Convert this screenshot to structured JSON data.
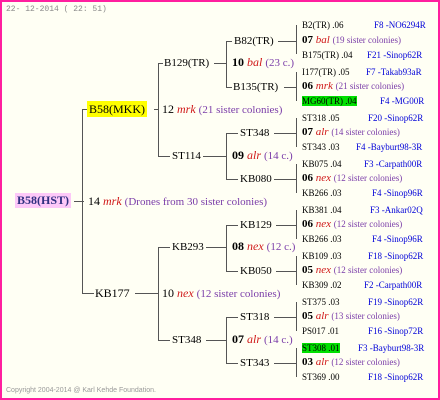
{
  "header": {
    "stamp": "22- 12-2014 ( 22: 51)"
  },
  "footer": {
    "copyright": "Copyright 2004-2014 @ Karl Kehde Foundation."
  },
  "root": {
    "name": "B58(HST)"
  },
  "gen1": {
    "drones": {
      "num": "14",
      "abbr": "mrk",
      "note": "(Drones from 30 sister colonies)"
    },
    "queen_top": {
      "name": "B58(MKK)",
      "num": "12",
      "abbr": "mrk",
      "note": "(21 sister colonies)"
    },
    "queen_bottom": {
      "name": "KB177",
      "num": "10",
      "abbr": "nex",
      "note": "(12 sister colonies)"
    }
  },
  "gen2": {
    "b129": {
      "name": "B129(TR)",
      "num": "10",
      "abbr": "bal",
      "note": "(23 c.)"
    },
    "st114": {
      "name": "ST114",
      "num": "09",
      "abbr": "alr",
      "note": "(14 c.)"
    },
    "kb293": {
      "name": "KB293",
      "num": "08",
      "abbr": "nex",
      "note": "(12 c.)"
    },
    "st348": {
      "name": "ST348",
      "num": "07",
      "abbr": "alr",
      "note": "(14 c.)"
    }
  },
  "gen3": {
    "b82": "B82(TR)",
    "b135": "B135(TR)",
    "st348": "ST348",
    "kb080": "KB080",
    "kb129": "KB129",
    "kb050": "KB050",
    "st318": "ST318",
    "st343": "ST343"
  },
  "gen4": [
    {
      "top": {
        "name": "B2(TR)",
        "yr": ".06",
        "loc": "F8 -NO6294R"
      },
      "num": "07",
      "abbr": "bal",
      "note": "(19 sister colonies)",
      "bottom": {
        "name": "B175(TR)",
        "yr": ".04",
        "loc": "F21 -Sinop62R"
      }
    },
    {
      "top": {
        "name": "I177(TR)",
        "yr": ".05",
        "loc": "F7 -Takab93aR"
      },
      "num": "06",
      "abbr": "mrk",
      "note": "(21 sister colonies)",
      "bottom": {
        "name": "MG60(TR)",
        "yr": ".04",
        "loc": "F4 -MG00R"
      }
    },
    {
      "top": {
        "name": "ST318",
        "yr": ".05",
        "loc": "F20 -Sinop62R"
      },
      "num": "07",
      "abbr": "alr",
      "note": "(14 sister colonies)",
      "bottom": {
        "name": "ST343",
        "yr": ".03",
        "loc": "F4 -Bayburt98-3R"
      }
    },
    {
      "top": {
        "name": "KB075",
        "yr": ".04",
        "loc": "F3 -Carpath00R"
      },
      "num": "06",
      "abbr": "nex",
      "note": "(12 sister colonies)",
      "bottom": {
        "name": "KB266",
        "yr": ".03",
        "loc": "F4 -Sinop96R"
      }
    },
    {
      "top": {
        "name": "KB381",
        "yr": ".04",
        "loc": "F3 -Ankar02Q"
      },
      "num": "06",
      "abbr": "nex",
      "note": "(12 sister colonies)",
      "bottom": {
        "name": "KB266",
        "yr": ".03",
        "loc": "F4 -Sinop96R"
      }
    },
    {
      "top": {
        "name": "KB109",
        "yr": ".03",
        "loc": "F18 -Sinop62R"
      },
      "num": "05",
      "abbr": "nex",
      "note": "(12 sister colonies)",
      "bottom": {
        "name": "KB309",
        "yr": ".02",
        "loc": "F2 -Carpath00R"
      }
    },
    {
      "top": {
        "name": "ST375",
        "yr": ".03",
        "loc": "F19 -Sinop62R"
      },
      "num": "05",
      "abbr": "alr",
      "note": "(13 sister colonies)",
      "bottom": {
        "name": "PS017",
        "yr": ".01",
        "loc": "F16 -Sinop72R"
      }
    },
    {
      "top": {
        "name": "ST308",
        "yr": ".01",
        "loc": "F3 -Bayburt98-3R"
      },
      "num": "03",
      "abbr": "alr",
      "note": "(12 sister colonies)",
      "bottom": {
        "name": "ST369",
        "yr": ".00",
        "loc": "F18 -Sinop62R"
      }
    }
  ],
  "colors": {
    "border": "#ff1f9f",
    "highlight_green": "#00e000",
    "highlight_yellow": "#ffff00",
    "root_pink": "#fdc8f8",
    "loc_blue": "#0000d8",
    "note_purple": "#7a3ca8",
    "abbr_red": "#d01818"
  }
}
